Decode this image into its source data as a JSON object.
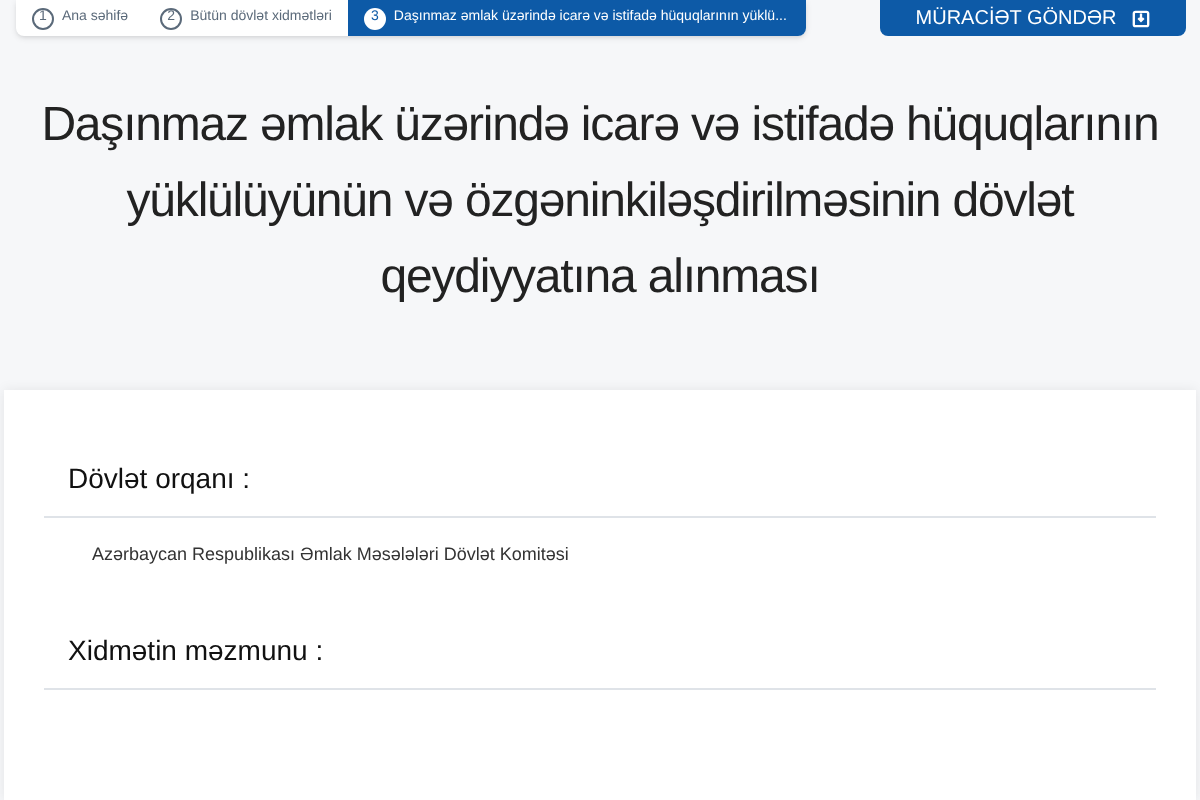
{
  "breadcrumb": [
    {
      "number": "1",
      "label": "Ana səhifə",
      "selected": false
    },
    {
      "number": "2",
      "label": "Bütün dövlət xidmətləri",
      "selected": false
    },
    {
      "number": "3",
      "label": "Daşınmaz əmlak üzərində icarə və istifadə hüquqlarının yüklü...",
      "selected": true
    }
  ],
  "submit_button": {
    "label": "MÜRACİƏT GÖNDƏR"
  },
  "title": "Daşınmaz əmlak üzərində icarə və istifadə hüquqlarının yüklülüyünün və özgəninkiləşdirilməsinin dövlət qeydiyyatına alınması",
  "sections": [
    {
      "heading": "Dövlət orqanı :",
      "value": "Azərbaycan Respublikası Əmlak Məsələləri Dövlət Komitəsi"
    },
    {
      "heading": "Xidmətin məzmunu :"
    }
  ]
}
